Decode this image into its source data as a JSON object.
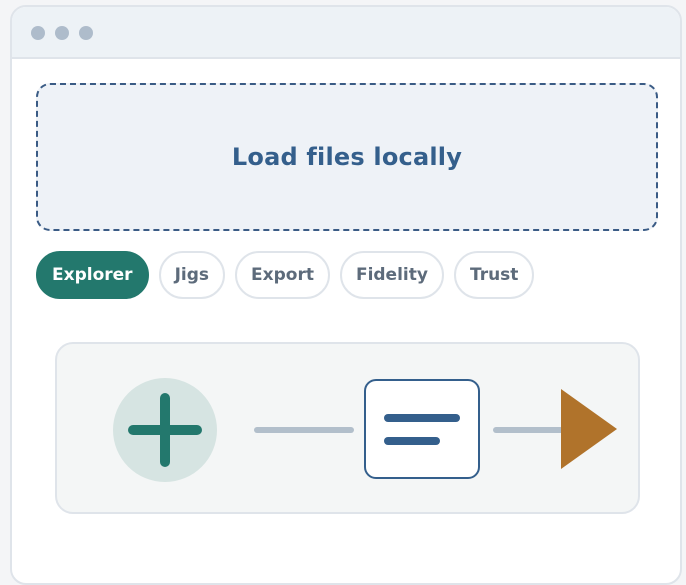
{
  "window": {
    "controls": [
      "window-dot",
      "window-dot",
      "window-dot"
    ]
  },
  "dropzone": {
    "label": "Load files locally"
  },
  "tabs": [
    {
      "label": "Explorer",
      "active": true
    },
    {
      "label": "Jigs",
      "active": false
    },
    {
      "label": "Export",
      "active": false
    },
    {
      "label": "Fidelity",
      "active": false
    },
    {
      "label": "Trust",
      "active": false
    }
  ],
  "flow": {
    "steps": [
      {
        "icon": "plus-icon"
      },
      {
        "icon": "document-lines-icon"
      },
      {
        "icon": "play-arrow-icon"
      }
    ]
  },
  "colors": {
    "accent": "#23786d",
    "primary": "#345f8c",
    "arrow": "#b0732b",
    "muted": "#b2bfcb"
  }
}
